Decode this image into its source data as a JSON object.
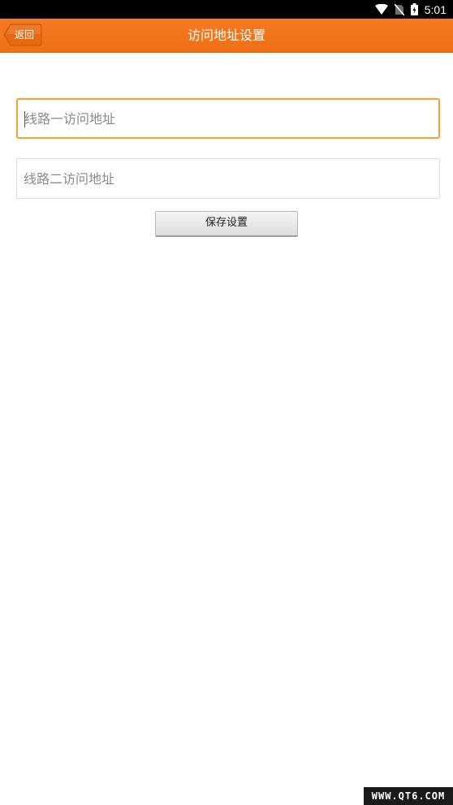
{
  "status_bar": {
    "time": "5:01",
    "icons": [
      "wifi-icon",
      "no-sim-icon",
      "battery-charging-icon"
    ]
  },
  "header": {
    "back_label": "返回",
    "title": "访问地址设置",
    "accent_color": "#f47a22"
  },
  "form": {
    "line1": {
      "value": "",
      "placeholder": "线路一访问地址"
    },
    "line2": {
      "value": "",
      "placeholder": "线路二访问地址"
    },
    "save_label": "保存设置"
  },
  "watermark": {
    "text": "WWW.QT6.COM"
  }
}
